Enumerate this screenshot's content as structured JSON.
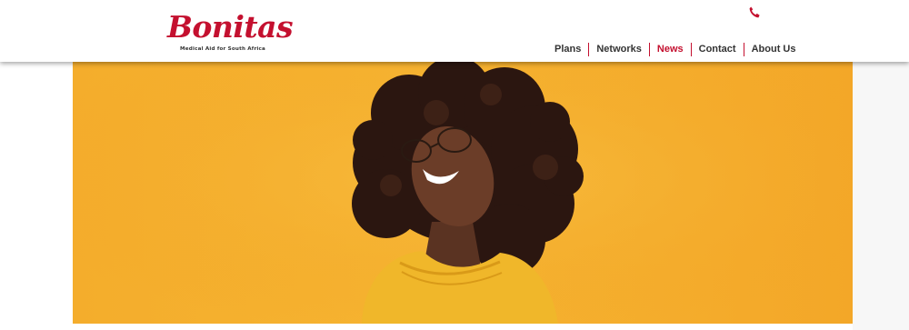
{
  "brand": {
    "name": "Bonitas",
    "tagline": "Medical Aid for South Africa",
    "color": "#c4102f"
  },
  "header": {
    "phone_icon": "phone-icon"
  },
  "nav": {
    "items": [
      {
        "label": "Plans"
      },
      {
        "label": "Networks"
      },
      {
        "label": "News",
        "active": true
      },
      {
        "label": "Contact"
      },
      {
        "label": "About Us"
      }
    ]
  },
  "hero": {
    "background_color": "#f5b02f"
  }
}
